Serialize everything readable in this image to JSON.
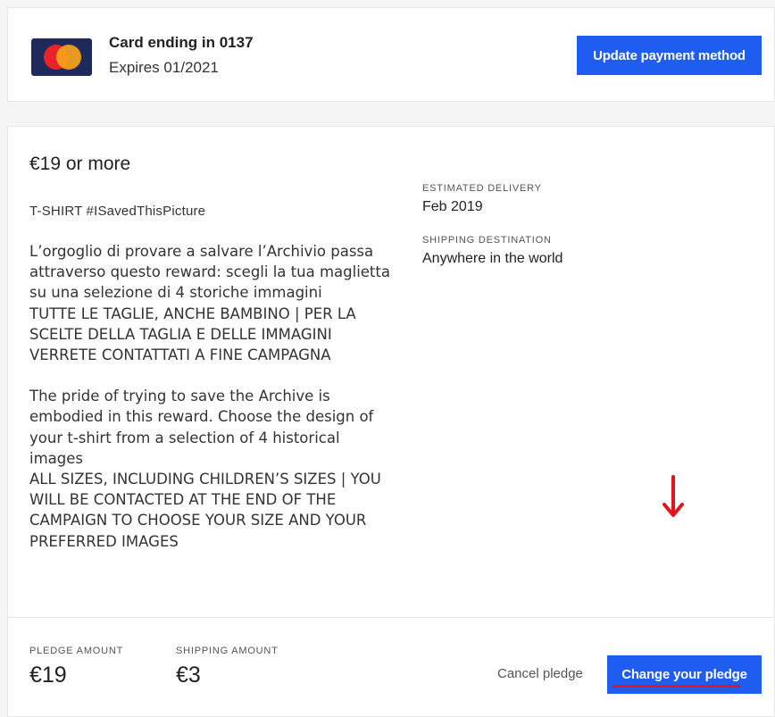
{
  "payment_card": {
    "title": "Card ending in 0137",
    "expiry": "Expires 01/2021",
    "brand_icon": "mastercard-icon",
    "update_button_label": "Update payment method"
  },
  "reward": {
    "price": "€19 or more",
    "title": "T-SHIRT #ISavedThisPicture",
    "description_it": "L’orgoglio di provare a salvare l’Archivio passa attraverso questo reward: scegli la tua maglietta su una selezione di 4 storiche immagini",
    "description_it_caps": "TUTTE LE TAGLIE, ANCHE BAMBINO | PER LA SCELTE DELLA TAGLIA E DELLE IMMAGINI VERRETE CONTATTATI A FINE CAMPAGNA",
    "description_en": "The pride of trying to save the Archive is embodied in this reward. Choose the design of your t-shirt from a selection of 4 historical images",
    "description_en_caps": "ALL SIZES, INCLUDING CHILDREN’S SIZES | YOU WILL BE CONTACTED AT THE END OF THE CAMPAIGN TO CHOOSE YOUR SIZE AND YOUR PREFERRED IMAGES",
    "estimated_delivery_label": "ESTIMATED DELIVERY",
    "estimated_delivery_value": "Feb 2019",
    "shipping_destination_label": "SHIPPING DESTINATION",
    "shipping_destination_value": "Anywhere in the world"
  },
  "pledge": {
    "pledge_amount_label": "PLEDGE AMOUNT",
    "pledge_amount_value": "€19",
    "shipping_amount_label": "SHIPPING AMOUNT",
    "shipping_amount_value": "€3",
    "cancel_label": "Cancel pledge",
    "change_label": "Change your pledge"
  },
  "colors": {
    "primary_button": "#1f5cf0",
    "annotation_red": "#e3141b"
  }
}
